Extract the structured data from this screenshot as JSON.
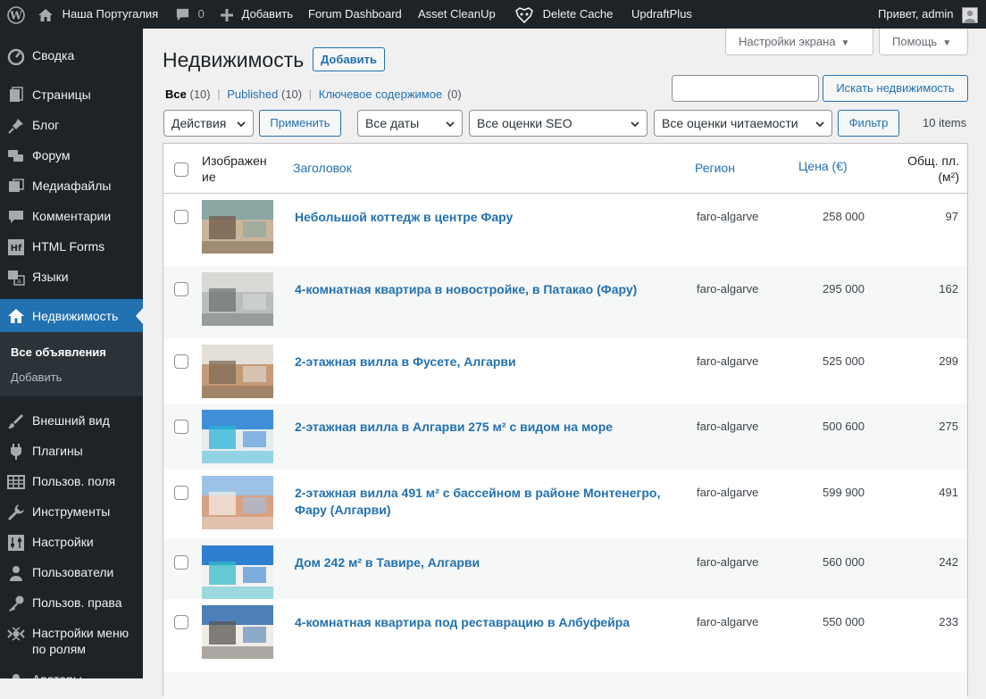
{
  "adminbar": {
    "site_name": "Наша Португалия",
    "comments_count": "0",
    "new_label": "Добавить",
    "forum_dashboard": "Forum Dashboard",
    "asset_cleanup": "Asset CleanUp",
    "delete_cache": "Delete Cache",
    "updraftplus": "UpdraftPlus",
    "greeting": "Привет, admin"
  },
  "menu": {
    "items": [
      {
        "label": "Сводка",
        "icon": "dashboard-icon"
      },
      {
        "label": "Страницы",
        "icon": "pages-icon"
      },
      {
        "label": "Блог",
        "icon": "pin-icon"
      },
      {
        "label": "Форум",
        "icon": "forum-icon"
      },
      {
        "label": "Медиафайлы",
        "icon": "media-icon"
      },
      {
        "label": "Комментарии",
        "icon": "comments-icon"
      },
      {
        "label": "HTML Forms",
        "icon": "hf-icon"
      },
      {
        "label": "Языки",
        "icon": "translation-icon"
      },
      {
        "label": "Недвижимость",
        "icon": "home-icon"
      },
      {
        "label": "Внешний вид",
        "icon": "brush-icon"
      },
      {
        "label": "Плагины",
        "icon": "plugin-icon"
      },
      {
        "label": "Пользов. поля",
        "icon": "fields-icon"
      },
      {
        "label": "Инструменты",
        "icon": "wrench-icon"
      },
      {
        "label": "Настройки",
        "icon": "settings-icon"
      },
      {
        "label": "Пользователи",
        "icon": "users-icon"
      },
      {
        "label": "Пользов. права",
        "icon": "key-icon"
      },
      {
        "label": "Настройки меню\nпо ролям",
        "icon": "menu-roles-icon"
      },
      {
        "label": "Аватары",
        "icon": "avatar-icon"
      }
    ],
    "submenu": [
      "Все объявления",
      "Добавить"
    ]
  },
  "screen_options": "Настройки экрана",
  "help": "Помощь",
  "page": {
    "title": "Недвижимость",
    "add_new": "Добавить"
  },
  "views": {
    "all_label": "Все",
    "all_count": "(10)",
    "published_label": "Published",
    "published_count": "(10)",
    "cornerstone_label": "Ключевое содержимое",
    "cornerstone_count": "(0)",
    "sep": "|"
  },
  "search": {
    "value": "",
    "button": "Искать недвижимость"
  },
  "filters": {
    "bulk_actions": "Действия",
    "apply": "Применить",
    "dates": "Все даты",
    "seo": "Все оценки SEO",
    "readability": "Все оценки читаемости",
    "filter": "Фильтр",
    "items_count": "10 items"
  },
  "table": {
    "columns": {
      "image": "Изображение",
      "title": "Заголовок",
      "region": "Регион",
      "price": "Цена (€)",
      "area": "Общ. пл. (м²)"
    },
    "rows": [
      {
        "title": "Небольшой коттедж в центре Фару",
        "region": "faro-algarve",
        "price": "258 000",
        "area": "97",
        "thumb": [
          "#8aa7a3",
          "#c9b59a",
          "#6e5a48"
        ]
      },
      {
        "title": "4-комнатная квартира в новостройке, в Патакао (Фару)",
        "region": "faro-algarve",
        "price": "295 000",
        "area": "162",
        "thumb": [
          "#d9d9d6",
          "#b8bdbd",
          "#6f7473"
        ]
      },
      {
        "title": "2-этажная вилла в Фусете, Алгарви",
        "region": "faro-algarve",
        "price": "525 000",
        "area": "299",
        "thumb": [
          "#e4e0d8",
          "#c49a76",
          "#7d6a58"
        ]
      },
      {
        "title": "2-этажная вилла в Алгарви 275 м² с видом на море",
        "region": "faro-algarve",
        "price": "500 600",
        "area": "275",
        "thumb": [
          "#3f8fd8",
          "#e9ecef",
          "#2cb5d8"
        ]
      },
      {
        "title": "2-этажная вилла 491 м² с бассейном в районе Монтенегро, Фару (Алгарви)",
        "region": "faro-algarve",
        "price": "599 900",
        "area": "491",
        "thumb": [
          "#9cc3e6",
          "#d7a184",
          "#f0ece4"
        ]
      },
      {
        "title": "Дом 242 м² в Тавире, Алгарви",
        "region": "faro-algarve",
        "price": "560 000",
        "area": "242",
        "thumb": [
          "#2f7fd0",
          "#f2f2f0",
          "#35b9c9"
        ]
      },
      {
        "title": "4-комнатная квартира под реставрацию в Албуфейра",
        "region": "faro-algarve",
        "price": "550 000",
        "area": "233",
        "thumb": [
          "#4d7fb8",
          "#efece6",
          "#5a5550"
        ]
      }
    ]
  }
}
